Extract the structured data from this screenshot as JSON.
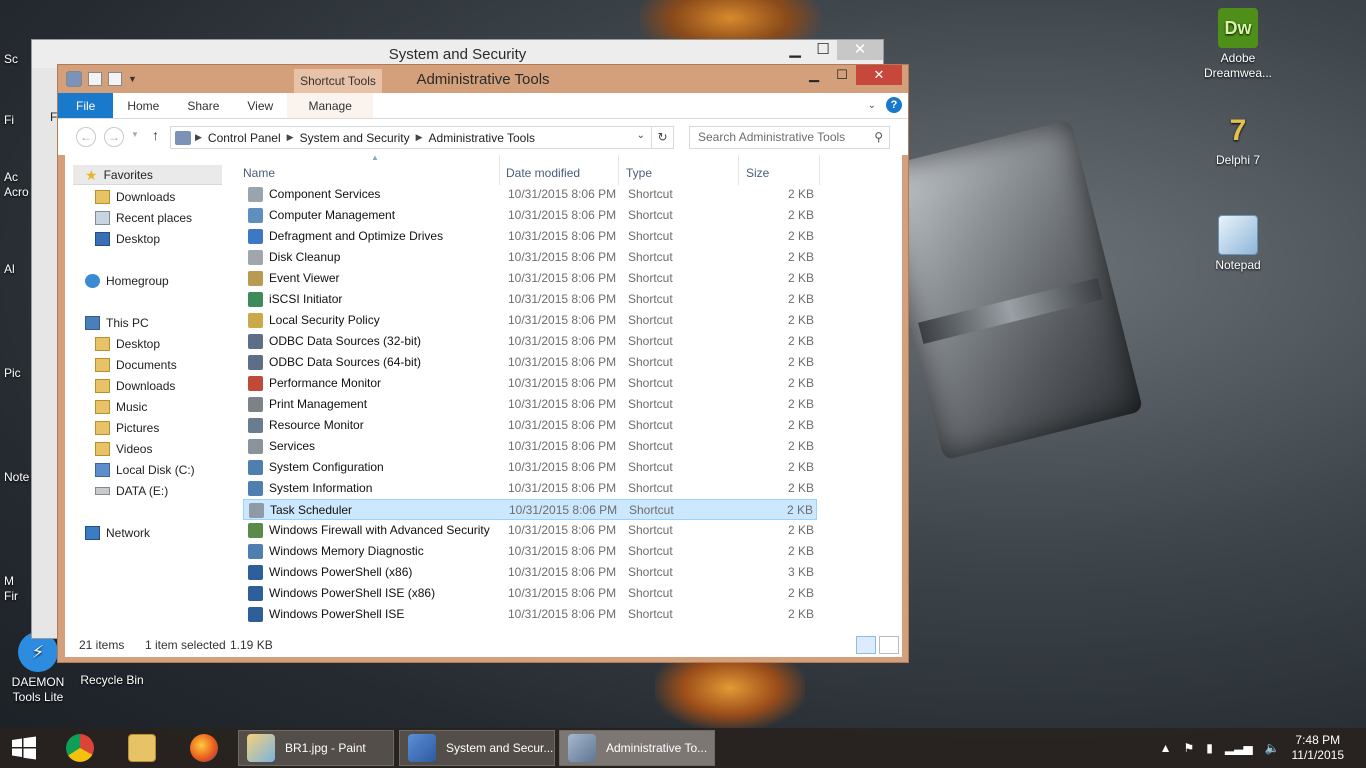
{
  "desktop": {
    "icons": [
      {
        "label": "Adobe\nDreamwea...",
        "icon": "dreamweaver-icon",
        "color": "#4e8f1a",
        "glyph": "Dw"
      },
      {
        "label": "Delphi 7",
        "icon": "delphi-icon",
        "color": "#c7a23a",
        "glyph": "7"
      },
      {
        "label": "Notepad",
        "icon": "notepad-icon",
        "color": "#8fb6d8",
        "glyph": ""
      },
      {
        "label": "DAEMON\nTools Lite",
        "icon": "daemon-tools-icon",
        "color": "#2c8ce0",
        "glyph": "⚡"
      },
      {
        "label": "Recycle Bin",
        "icon": "recycle-bin-icon",
        "color": "#cfd5da",
        "glyph": ""
      }
    ],
    "left_partial": [
      "Sc",
      "Fi",
      "Ac",
      "Acro",
      "Al",
      "Pic",
      "Note",
      "M",
      "Fir"
    ]
  },
  "back_window": {
    "title": "System and Security",
    "menu_partial": "Fi"
  },
  "window": {
    "title": "Administrative Tools",
    "context_tab": "Shortcut Tools",
    "controls": {
      "minimize": "▁",
      "maximize": "☐",
      "close": "✕"
    },
    "ribbon_tabs": [
      "File",
      "Home",
      "Share",
      "View",
      "Manage"
    ],
    "help": "?",
    "breadcrumb": [
      "Control Panel",
      "System and Security",
      "Administrative Tools"
    ],
    "search_placeholder": "Search Administrative Tools",
    "nav": {
      "favorites": "Favorites",
      "fav_items": [
        "Downloads",
        "Recent places",
        "Desktop"
      ],
      "homegroup": "Homegroup",
      "this_pc": "This PC",
      "pc_items": [
        "Desktop",
        "Documents",
        "Downloads",
        "Music",
        "Pictures",
        "Videos",
        "Local Disk (C:)",
        "DATA (E:)"
      ],
      "network": "Network"
    },
    "columns": [
      "Name",
      "Date modified",
      "Type",
      "Size"
    ],
    "files": [
      {
        "name": "Component Services",
        "date": "10/31/2015 8:06 PM",
        "type": "Shortcut",
        "size": "2 KB",
        "color": "#9aa4ad"
      },
      {
        "name": "Computer Management",
        "date": "10/31/2015 8:06 PM",
        "type": "Shortcut",
        "size": "2 KB",
        "color": "#5f8fbd"
      },
      {
        "name": "Defragment and Optimize Drives",
        "date": "10/31/2015 8:06 PM",
        "type": "Shortcut",
        "size": "2 KB",
        "color": "#3e78c4"
      },
      {
        "name": "Disk Cleanup",
        "date": "10/31/2015 8:06 PM",
        "type": "Shortcut",
        "size": "2 KB",
        "color": "#9fa7ad"
      },
      {
        "name": "Event Viewer",
        "date": "10/31/2015 8:06 PM",
        "type": "Shortcut",
        "size": "2 KB",
        "color": "#b89a52"
      },
      {
        "name": "iSCSI Initiator",
        "date": "10/31/2015 8:06 PM",
        "type": "Shortcut",
        "size": "2 KB",
        "color": "#3f8a5a"
      },
      {
        "name": "Local Security Policy",
        "date": "10/31/2015 8:06 PM",
        "type": "Shortcut",
        "size": "2 KB",
        "color": "#c9a94a"
      },
      {
        "name": "ODBC Data Sources (32-bit)",
        "date": "10/31/2015 8:06 PM",
        "type": "Shortcut",
        "size": "2 KB",
        "color": "#5c6f86"
      },
      {
        "name": "ODBC Data Sources (64-bit)",
        "date": "10/31/2015 8:06 PM",
        "type": "Shortcut",
        "size": "2 KB",
        "color": "#5c6f86"
      },
      {
        "name": "Performance Monitor",
        "date": "10/31/2015 8:06 PM",
        "type": "Shortcut",
        "size": "2 KB",
        "color": "#c04a3a"
      },
      {
        "name": "Print Management",
        "date": "10/31/2015 8:06 PM",
        "type": "Shortcut",
        "size": "2 KB",
        "color": "#7b8288"
      },
      {
        "name": "Resource Monitor",
        "date": "10/31/2015 8:06 PM",
        "type": "Shortcut",
        "size": "2 KB",
        "color": "#6a7d8f"
      },
      {
        "name": "Services",
        "date": "10/31/2015 8:06 PM",
        "type": "Shortcut",
        "size": "2 KB",
        "color": "#8a9399"
      },
      {
        "name": "System Configuration",
        "date": "10/31/2015 8:06 PM",
        "type": "Shortcut",
        "size": "2 KB",
        "color": "#4f7fb0"
      },
      {
        "name": "System Information",
        "date": "10/31/2015 8:06 PM",
        "type": "Shortcut",
        "size": "2 KB",
        "color": "#4f7fb0"
      },
      {
        "name": "Task Scheduler",
        "date": "10/31/2015 8:06 PM",
        "type": "Shortcut",
        "size": "2 KB",
        "color": "#8f9aa4",
        "selected": true
      },
      {
        "name": "Windows Firewall with Advanced Security",
        "date": "10/31/2015 8:06 PM",
        "type": "Shortcut",
        "size": "2 KB",
        "color": "#5b8a4a"
      },
      {
        "name": "Windows Memory Diagnostic",
        "date": "10/31/2015 8:06 PM",
        "type": "Shortcut",
        "size": "2 KB",
        "color": "#4f7fb0"
      },
      {
        "name": "Windows PowerShell (x86)",
        "date": "10/31/2015 8:06 PM",
        "type": "Shortcut",
        "size": "3 KB",
        "color": "#2f5f9a"
      },
      {
        "name": "Windows PowerShell ISE (x86)",
        "date": "10/31/2015 8:06 PM",
        "type": "Shortcut",
        "size": "2 KB",
        "color": "#2f5f9a"
      },
      {
        "name": "Windows PowerShell ISE",
        "date": "10/31/2015 8:06 PM",
        "type": "Shortcut",
        "size": "2 KB",
        "color": "#2f5f9a"
      }
    ],
    "status": {
      "count": "21 items",
      "selection": "1 item selected",
      "size": "1.19 KB"
    }
  },
  "taskbar": {
    "apps": [
      {
        "label": "BR1.jpg - Paint",
        "icon": "paint-icon"
      },
      {
        "label": "System and Secur...",
        "icon": "shield-icon"
      },
      {
        "label": "Administrative To...",
        "icon": "admin-tools-icon"
      }
    ],
    "time": "7:48 PM",
    "date": "11/1/2015"
  }
}
